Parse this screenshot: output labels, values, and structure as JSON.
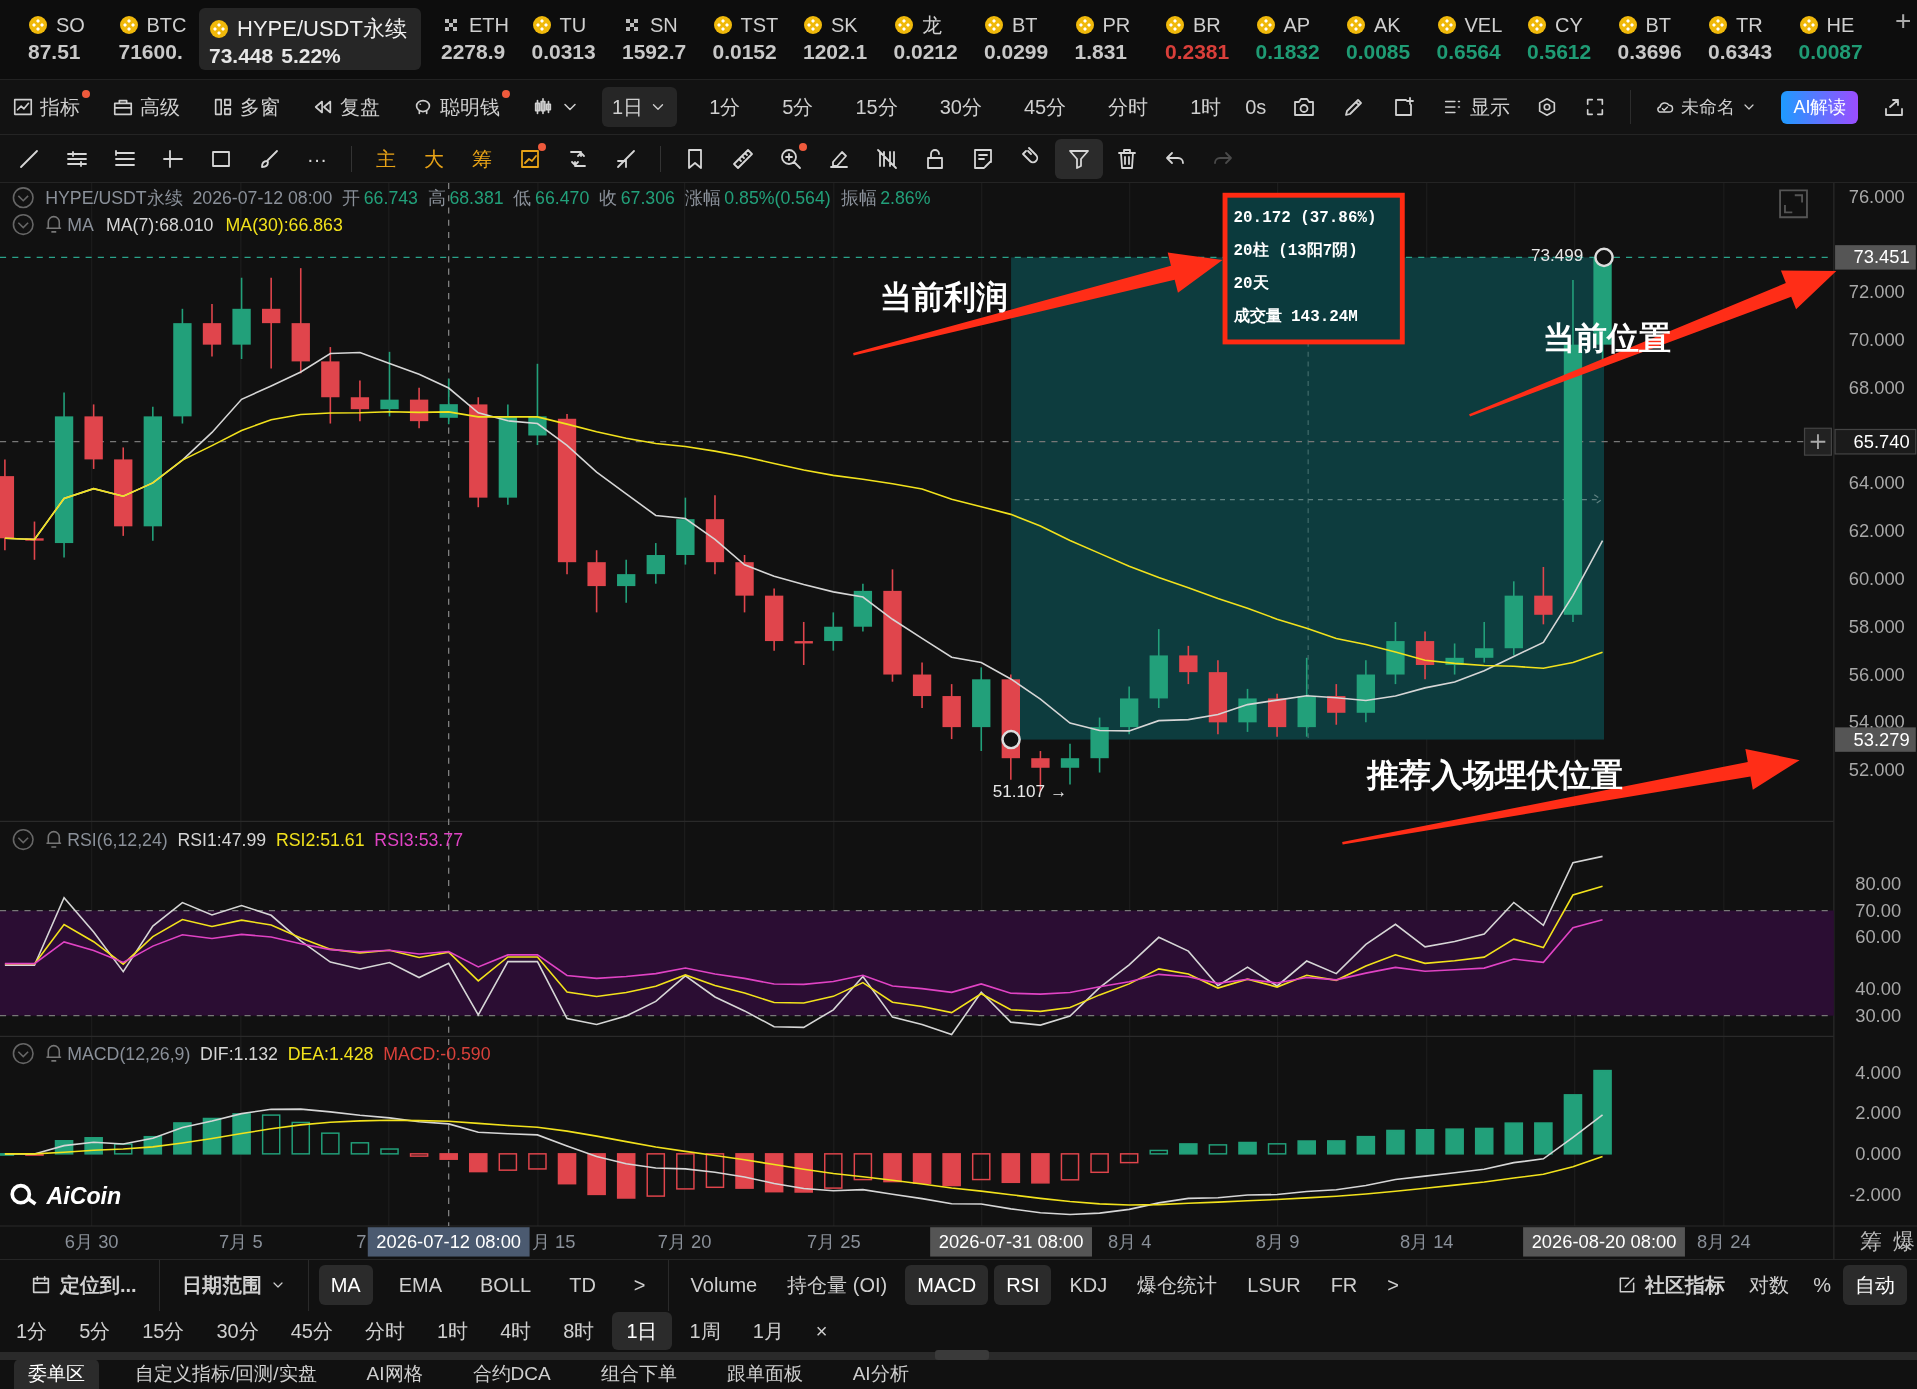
{
  "tickers": [
    {
      "kind": "coin",
      "symbol": "SO",
      "price": "87.51",
      "color": "#c8c8c8",
      "selected": false
    },
    {
      "kind": "coin",
      "symbol": "BTC",
      "price": "71600.",
      "color": "#c8c8c8",
      "selected": false
    },
    {
      "kind": "coin",
      "symbol": "HYPE/USDT永续",
      "price": "73.448",
      "change": "5.22%",
      "color": "#e6e6e6",
      "selected": true
    },
    {
      "kind": "cross",
      "symbol": "ETH",
      "price": "2278.9",
      "color": "#c8c8c8",
      "selected": false
    },
    {
      "kind": "coin",
      "symbol": "TU",
      "price": "0.0313",
      "color": "#c8c8c8",
      "selected": false
    },
    {
      "kind": "cross",
      "symbol": "SN",
      "price": "1592.7",
      "color": "#c8c8c8",
      "selected": false
    },
    {
      "kind": "coin",
      "symbol": "TST",
      "price": "0.0152",
      "color": "#c8c8c8",
      "selected": false
    },
    {
      "kind": "coin",
      "symbol": "SK",
      "price": "1202.1",
      "color": "#c8c8c8",
      "selected": false
    },
    {
      "kind": "coin",
      "symbol": "龙",
      "price": "0.0212",
      "color": "#c8c8c8",
      "selected": false
    },
    {
      "kind": "coin",
      "symbol": "BT",
      "price": "0.0299",
      "color": "#c8c8c8",
      "selected": false
    },
    {
      "kind": "coin",
      "symbol": "PR",
      "price": "1.831",
      "color": "#c8c8c8",
      "selected": false
    },
    {
      "kind": "coin",
      "symbol": "BR",
      "price": "0.2381",
      "color": "#d93f3a",
      "selected": false
    },
    {
      "kind": "coin",
      "symbol": "AP",
      "price": "0.1832",
      "color": "#1f9b74",
      "selected": false
    },
    {
      "kind": "coin",
      "symbol": "AK",
      "price": "0.0085",
      "color": "#1f9b74",
      "selected": false
    },
    {
      "kind": "coin",
      "symbol": "VEL",
      "price": "0.6564",
      "color": "#1f9b74",
      "selected": false
    },
    {
      "kind": "coin",
      "symbol": "CY",
      "price": "0.5612",
      "color": "#1f9b74",
      "selected": false
    },
    {
      "kind": "coin",
      "symbol": "BT",
      "price": "0.3696",
      "color": "#c8c8c8",
      "selected": false
    },
    {
      "kind": "coin",
      "symbol": "TR",
      "price": "0.6343",
      "color": "#c8c8c8",
      "selected": false
    },
    {
      "kind": "coin",
      "symbol": "HE",
      "price": "0.0087",
      "color": "#1f9b74",
      "selected": false
    }
  ],
  "add_tab": "+",
  "toolbar": {
    "items": [
      {
        "kind": "indicator",
        "label": "指标",
        "badge": true
      },
      {
        "kind": "advanced",
        "label": "高级",
        "badge": false
      },
      {
        "kind": "multi",
        "label": "多窗",
        "badge": false
      },
      {
        "kind": "replay",
        "label": "复盘",
        "badge": false
      },
      {
        "kind": "smart",
        "label": "聪明钱",
        "badge": true
      }
    ],
    "interval": "1日",
    "periods": [
      "1分",
      "5分",
      "15分",
      "30分",
      "45分",
      "分时",
      "1时"
    ],
    "countdown": "0s",
    "display": "显示",
    "layout_name": "未命名",
    "ai_button": "AI解读"
  },
  "draw_tools": [
    {
      "kind": "line"
    },
    {
      "kind": "parallel"
    },
    {
      "kind": "hlines"
    },
    {
      "kind": "hsegment"
    },
    {
      "kind": "rect"
    },
    {
      "kind": "brush"
    },
    {
      "kind": "more",
      "label": "···"
    }
  ],
  "overlay_tools": [
    {
      "kind": "text",
      "label": "主",
      "badge": false
    },
    {
      "kind": "text",
      "label": "大",
      "badge": false
    },
    {
      "kind": "text",
      "label": "筹",
      "badge": false
    },
    {
      "kind": "chip",
      "badge": true
    },
    {
      "kind": "swap",
      "badge": false
    },
    {
      "kind": "crosslines",
      "badge": false
    }
  ],
  "edit_tools": [
    {
      "kind": "bookmark",
      "selected": false,
      "disabled": false,
      "badge": false
    },
    {
      "kind": "ruler",
      "selected": false,
      "disabled": false,
      "badge": false
    },
    {
      "kind": "zoom",
      "selected": false,
      "disabled": false,
      "badge": true
    },
    {
      "kind": "eraser",
      "selected": false,
      "disabled": false,
      "badge": false
    },
    {
      "kind": "hidelink",
      "selected": false,
      "disabled": false,
      "badge": false
    },
    {
      "kind": "lock",
      "selected": false,
      "disabled": false,
      "badge": false
    },
    {
      "kind": "note",
      "selected": false,
      "disabled": false,
      "badge": false
    },
    {
      "kind": "magnet",
      "selected": false,
      "disabled": false,
      "badge": false
    },
    {
      "kind": "filter",
      "selected": true,
      "disabled": false,
      "badge": false
    },
    {
      "kind": "trash",
      "selected": false,
      "disabled": false,
      "badge": false
    },
    {
      "kind": "undo",
      "selected": false,
      "disabled": false,
      "badge": false
    },
    {
      "kind": "redo",
      "selected": false,
      "disabled": true,
      "badge": false
    }
  ],
  "chart": {
    "legend": {
      "symbol": "HYPE/USDT永续",
      "time": "2026-07-12 08:00",
      "fields": [
        {
          "label": "开",
          "value": "66.743"
        },
        {
          "label": "高",
          "value": "68.381"
        },
        {
          "label": "低",
          "value": "66.470"
        },
        {
          "label": "收",
          "value": "67.306"
        },
        {
          "label": "涨幅",
          "value": "0.85%(0.564)"
        },
        {
          "label": "振幅",
          "value": "2.86%"
        }
      ]
    },
    "ma": {
      "name": "MA",
      "lines": [
        {
          "text": "MA(7):68.010",
          "color": "#d6d6d6"
        },
        {
          "text": "MA(30):66.863",
          "color": "#f2e21c"
        }
      ]
    },
    "y_ticks": [
      "76.000",
      "72.000",
      "70.000",
      "68.000",
      "64.000",
      "62.000",
      "60.000",
      "58.000",
      "56.000",
      "54.000",
      "52.000"
    ],
    "price_flags": [
      {
        "kind": "current",
        "text": "73.451"
      },
      {
        "kind": "cursor",
        "text": "65.740"
      },
      {
        "kind": "start",
        "text": "53.279"
      }
    ],
    "measure": {
      "lines": [
        "20.172 (37.86%)",
        "20柱 (13阳7阴)",
        "20天",
        "成交量 143.24M"
      ],
      "high_label": "73.499",
      "low_label": "51.107 →"
    },
    "annotations": [
      {
        "text": "当前利润"
      },
      {
        "text": "当前位置"
      },
      {
        "text": "推荐入场埋伏位置"
      }
    ],
    "logo": "AiCoin"
  },
  "rsi": {
    "name": "RSI(6,12,24)",
    "lines": [
      {
        "text": "RSI1:47.99",
        "color": "#d6d6d6"
      },
      {
        "text": "RSI2:51.61",
        "color": "#f2e21c"
      },
      {
        "text": "RSI3:53.77",
        "color": "#e043c4"
      }
    ],
    "y_ticks": [
      "80.00",
      "70.00",
      "60.00",
      "40.00",
      "30.00"
    ]
  },
  "macd": {
    "name": "MACD(12,26,9)",
    "lines": [
      {
        "text": "DIF:1.132",
        "color": "#d6d6d6"
      },
      {
        "text": "DEA:1.428",
        "color": "#f2e21c"
      },
      {
        "text": "MACD:-0.590",
        "color": "#d9403a"
      }
    ],
    "y_ticks": [
      "4.000",
      "2.000",
      "0.000",
      "-2.000"
    ]
  },
  "x_axis": {
    "labels": [
      {
        "kind": "date",
        "text": "6月 30"
      },
      {
        "kind": "date",
        "text": "7月 5"
      },
      {
        "kind": "date",
        "text": "7"
      },
      {
        "kind": "crosshair",
        "text": "2026-07-12 08:00"
      },
      {
        "kind": "date",
        "text": "月 15"
      },
      {
        "kind": "date",
        "text": "7月 20"
      },
      {
        "kind": "date",
        "text": "7月 25"
      },
      {
        "kind": "marker",
        "text": "2026-07-31 08:00"
      },
      {
        "kind": "date",
        "text": "8月 4"
      },
      {
        "kind": "date",
        "text": "8月 9"
      },
      {
        "kind": "date",
        "text": "8月 14"
      },
      {
        "kind": "marker",
        "text": "2026-08-20 08:00"
      },
      {
        "kind": "date",
        "text": "8月 24"
      }
    ],
    "right_labels": [
      "筹",
      "爆"
    ]
  },
  "bottom": {
    "locate": "定位到...",
    "date_range": "日期范围",
    "main_indicators": [
      {
        "label": "MA",
        "selected": true
      },
      {
        "label": "EMA",
        "selected": false
      },
      {
        "label": "BOLL",
        "selected": false
      },
      {
        "label": "TD",
        "selected": false
      }
    ],
    "main_more": ">",
    "sub_indicators": [
      {
        "label": "Volume",
        "selected": false
      },
      {
        "label": "持仓量 (OI)",
        "selected": false
      },
      {
        "label": "MACD",
        "selected": true
      },
      {
        "label": "RSI",
        "selected": true
      },
      {
        "label": "KDJ",
        "selected": false
      },
      {
        "label": "爆仓统计",
        "selected": false
      },
      {
        "label": "LSUR",
        "selected": false
      },
      {
        "label": "FR",
        "selected": false
      }
    ],
    "sub_more": ">",
    "community": "社区指标",
    "scale_options": [
      {
        "label": "对数",
        "selected": false
      },
      {
        "label": "%",
        "selected": false
      },
      {
        "label": "自动",
        "selected": true
      }
    ],
    "periods": [
      {
        "label": "1分",
        "selected": false
      },
      {
        "label": "5分",
        "selected": false
      },
      {
        "label": "15分",
        "selected": false
      },
      {
        "label": "30分",
        "selected": false
      },
      {
        "label": "45分",
        "selected": false
      },
      {
        "label": "分时",
        "selected": false
      },
      {
        "label": "1时",
        "selected": false
      },
      {
        "label": "4时",
        "selected": false
      },
      {
        "label": "8时",
        "selected": false
      },
      {
        "label": "1日",
        "selected": true
      },
      {
        "label": "1周",
        "selected": false
      },
      {
        "label": "1月",
        "selected": false
      }
    ],
    "close": "×",
    "tabs": [
      {
        "label": "委单区",
        "selected": true
      },
      {
        "label": "自定义指标/回测/实盘",
        "selected": false
      },
      {
        "label": "AI网格",
        "selected": false
      },
      {
        "label": "合约DCA",
        "selected": false
      },
      {
        "label": "组合下单",
        "selected": false
      },
      {
        "label": "跟单面板",
        "selected": false
      },
      {
        "label": "AI分析",
        "selected": false
      }
    ]
  }
}
